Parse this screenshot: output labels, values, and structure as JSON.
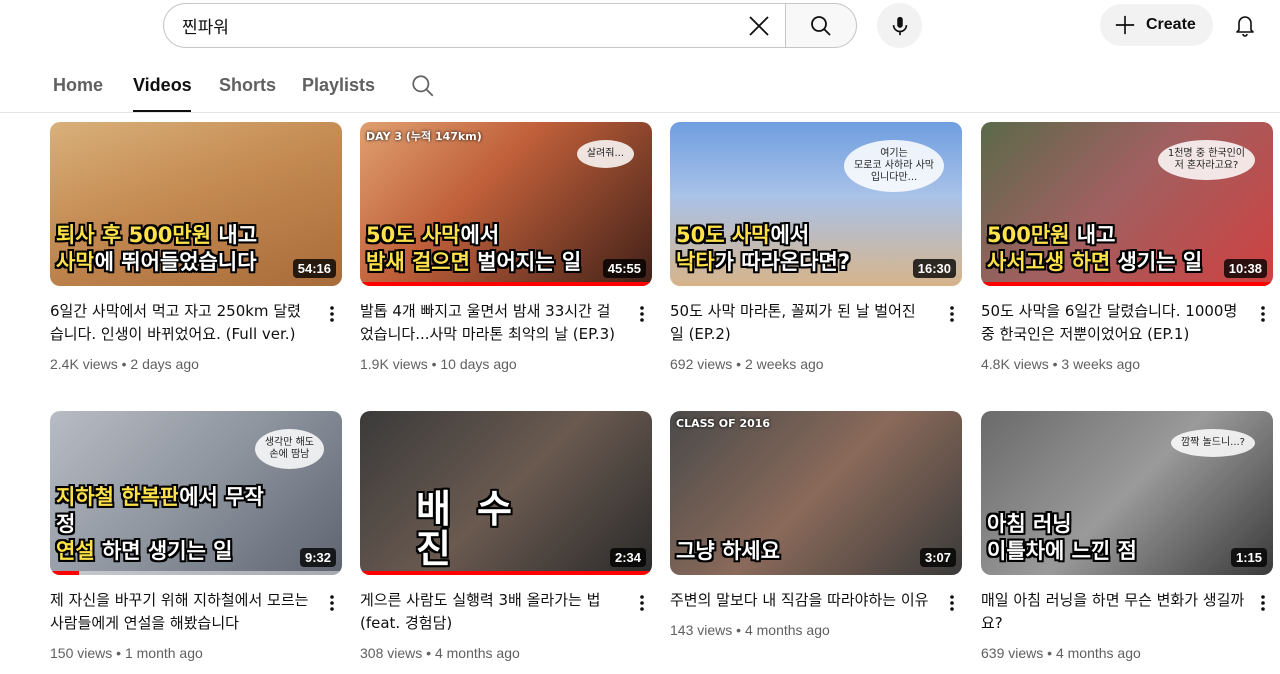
{
  "search": {
    "query": "찐파워"
  },
  "header": {
    "create_label": "Create"
  },
  "tabs": [
    {
      "label": "Home"
    },
    {
      "label": "Videos",
      "active": true
    },
    {
      "label": "Shorts"
    },
    {
      "label": "Playlists"
    }
  ],
  "colors": {
    "progress": "#ff0000",
    "caption_highlight": "#ffe24a",
    "meta_text": "#606060"
  },
  "videos": [
    {
      "title": "6일간 사막에서 먹고 자고 250km 달렸습니다. 인생이 바뀌었어요. (Full ver.)",
      "views": "2.4K views",
      "age": "2 days ago",
      "duration": "54:16",
      "caption_line1_hl": "퇴사 후 500만원",
      "caption_line1": " 내고",
      "caption_line2_hl": "사막",
      "caption_line2": "에 뛰어들었습니다",
      "progress": 0.0
    },
    {
      "title": "발톱 4개 빠지고 울면서 밤새 33시간 걸었습니다...사막 마라톤 최악의 날 (EP.3)",
      "views": "1.9K views",
      "age": "10 days ago",
      "duration": "45:55",
      "caption_line1_hl": "50도 사막",
      "caption_line1": "에서",
      "caption_line2_hl": "밤새 걸으면",
      "caption_line2": " 벌어지는 일",
      "corner": "DAY 3 (누적 147km)",
      "bubble": "살려줘...",
      "progress": 1.0
    },
    {
      "title": "50도 사막 마라톤, 꼴찌가 된 날 벌어진 일 (EP.2)",
      "views": "692 views",
      "age": "2 weeks ago",
      "duration": "16:30",
      "caption_line1_hl": "50도 사막",
      "caption_line1": "에서",
      "caption_line2_hl": "낙타",
      "caption_line2": "가 따라온다면?",
      "bubble": "여기는\n모로코 사하라 사막\n입니다만...",
      "progress": 0.0
    },
    {
      "title": "50도 사막을 6일간 달렸습니다. 1000명 중 한국인은 저뿐이었어요 (EP.1)",
      "views": "4.8K views",
      "age": "3 weeks ago",
      "duration": "10:38",
      "caption_line1_hl": "500만원",
      "caption_line1": " 내고",
      "caption_line2_hl": "사서고생 하면",
      "caption_line2": " 생기는 일",
      "bubble": "1천명 중 한국인이\n저 혼자라고요?",
      "progress": 1.0
    },
    {
      "title": "제 자신을 바꾸기 위해 지하철에서 모르는 사람들에게 연설을 해봤습니다",
      "views": "150 views",
      "age": "1 month ago",
      "duration": "9:32",
      "caption_line1_hl": "지하철 한복판",
      "caption_line1": "에서 무작정",
      "caption_line2_hl": "연설",
      "caption_line2": " 하면 생기는 일",
      "bubble": "생각만 해도\n손에 땀남",
      "progress": 0.1
    },
    {
      "title": "게으른 사람도 실행력 3배 올라가는 법 (feat. 경험담)",
      "views": "308 views",
      "age": "4 months ago",
      "duration": "2:34",
      "caption_big": "배수진",
      "progress": 1.0
    },
    {
      "title": "주변의 말보다 내 직감을 따라야하는 이유",
      "views": "143 views",
      "age": "4 months ago",
      "duration": "3:07",
      "caption_line1_hl": "",
      "caption_line1": "",
      "caption_line2_hl": "",
      "caption_line2": "그냥 하세요",
      "corner": "CLASS OF 2016",
      "progress": 0.0
    },
    {
      "title": "매일 아침 러닝을 하면 무슨 변화가 생길까요?",
      "views": "639 views",
      "age": "4 months ago",
      "duration": "1:15",
      "caption_line1_hl": "",
      "caption_line1": "아침 러닝",
      "caption_line2_hl": "",
      "caption_line2": "이틀차에 느낀 점",
      "bubble": "깜짝 놀드니...?",
      "progress": 0.0
    }
  ]
}
